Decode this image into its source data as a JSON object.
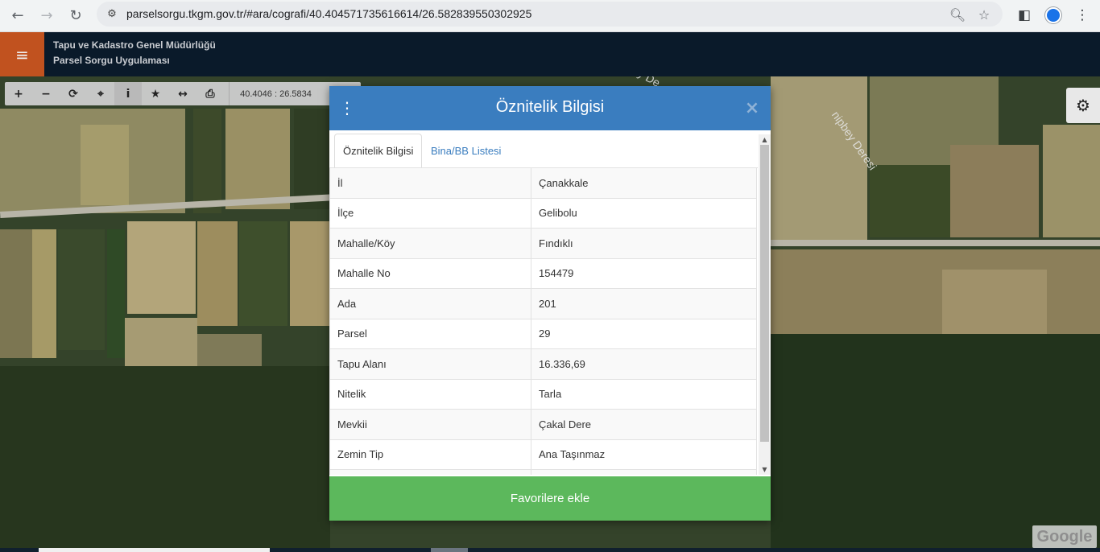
{
  "browser": {
    "url": "parselsorgu.tkgm.gov.tr/#ara/cografi/40.404571735616614/26.582839550302925",
    "back_icon": "arrow-left-icon",
    "forward_icon": "arrow-right-icon",
    "reload_icon": "reload-icon"
  },
  "header": {
    "title_line1": "Tapu ve Kadastro Genel Müdürlüğü",
    "title_line2": "Parsel Sorgu Uygulaması"
  },
  "toolbar": {
    "tools": [
      "zoom-in",
      "zoom-out",
      "refresh",
      "locate",
      "info",
      "favorites",
      "measure",
      "print"
    ],
    "coordinates": "40.4046 : 26.5834"
  },
  "map": {
    "labels": [
      "nipbey Deresi",
      "pbey De"
    ],
    "watermark": "Google"
  },
  "modal": {
    "title": "Öznitelik Bilgisi",
    "tabs": [
      {
        "label": "Öznitelik Bilgisi",
        "active": true
      },
      {
        "label": "Bina/BB Listesi",
        "active": false
      }
    ],
    "rows": [
      {
        "key": "İl",
        "value": "Çanakkale"
      },
      {
        "key": "İlçe",
        "value": "Gelibolu"
      },
      {
        "key": "Mahalle/Köy",
        "value": "Fındıklı"
      },
      {
        "key": "Mahalle No",
        "value": "154479"
      },
      {
        "key": "Ada",
        "value": "201"
      },
      {
        "key": "Parsel",
        "value": "29"
      },
      {
        "key": "Tapu Alanı",
        "value": "16.336,69"
      },
      {
        "key": "Nitelik",
        "value": "Tarla"
      },
      {
        "key": "Mevkii",
        "value": "Çakal Dere"
      },
      {
        "key": "Zemin Tip",
        "value": "Ana Taşınmaz"
      }
    ],
    "favorite_button": "Favorilere ekle"
  },
  "colors": {
    "modal_header": "#3a7dbf",
    "favorite_button": "#5cb85c",
    "menu_button": "#c1521f",
    "app_header": "#0a1a2a"
  }
}
